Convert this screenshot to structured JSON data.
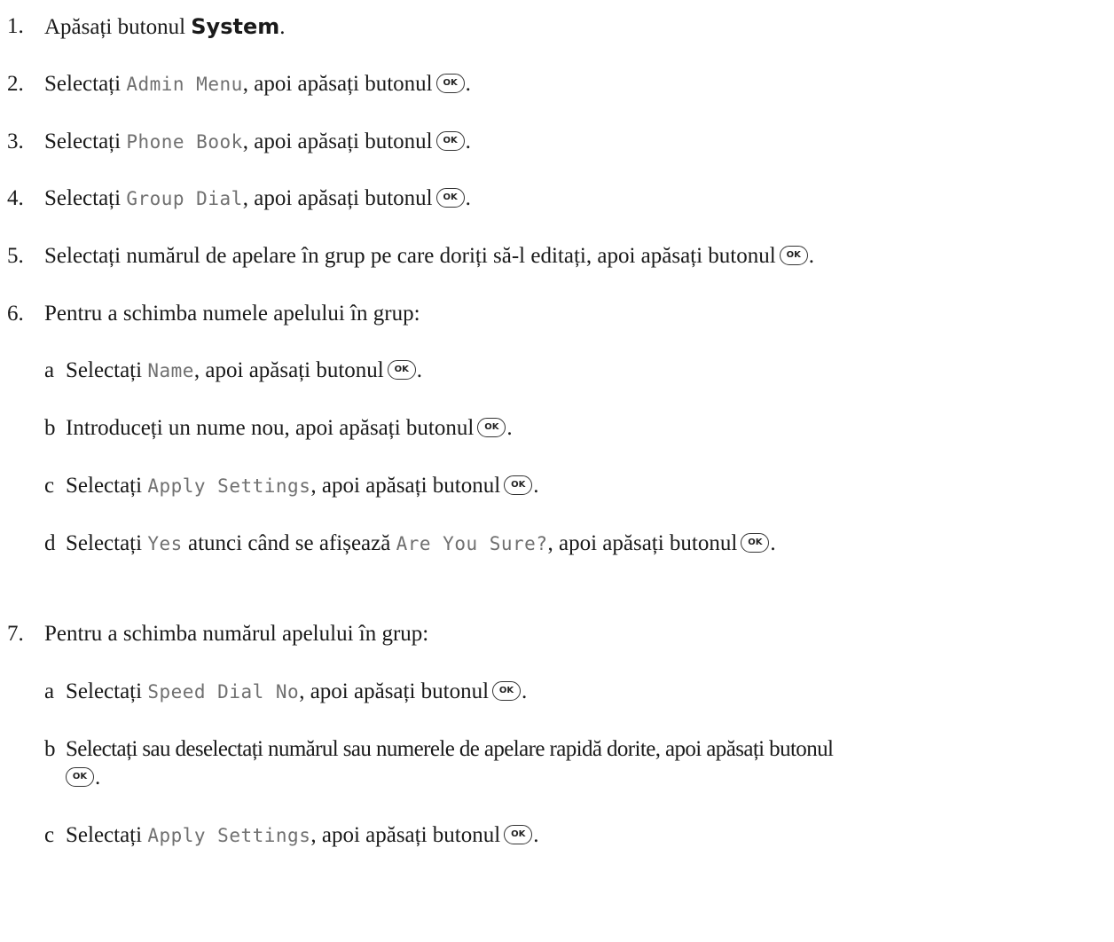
{
  "steps": [
    {
      "num": "1.",
      "pre": "Apăsați butonul ",
      "bold": "System",
      "post": "."
    },
    {
      "num": "2.",
      "pre": "Selectați ",
      "lcd": "Admin Menu",
      "post": ", apoi apăsați butonul",
      "end": "."
    },
    {
      "num": "3.",
      "pre": "Selectați ",
      "lcd": "Phone Book",
      "post": ", apoi apăsați butonul",
      "end": "."
    },
    {
      "num": "4.",
      "pre": "Selectați ",
      "lcd": "Group Dial",
      "post": ", apoi apăsați butonul",
      "end": "."
    },
    {
      "num": "5.",
      "text": "Selectați numărul de apelare în grup pe care doriți să-l editați, apoi apăsați butonul",
      "end": "."
    },
    {
      "num": "6.",
      "text": "Pentru a schimba numele apelului în grup:"
    },
    {
      "num": "7.",
      "text": "Pentru a schimba numărul apelului în grup:"
    }
  ],
  "step6_sub": [
    {
      "letter": "a",
      "pre": "Selectați ",
      "lcd": "Name",
      "post": ", apoi apăsați butonul",
      "end": "."
    },
    {
      "letter": "b",
      "text": "Introduceți un nume nou, apoi apăsați butonul",
      "end": "."
    },
    {
      "letter": "c",
      "pre": "Selectați ",
      "lcd": "Apply Settings",
      "post": ", apoi apăsați butonul",
      "end": "."
    },
    {
      "letter": "d",
      "pre": "Selectați ",
      "lcd": "Yes",
      "mid": " atunci când se afișează ",
      "lcd2": "Are You Sure?",
      "post": ", apoi apăsați butonul",
      "end": "."
    }
  ],
  "step7_sub": [
    {
      "letter": "a",
      "pre": "Selectați ",
      "lcd": "Speed Dial No",
      "post": ", apoi apăsați butonul",
      "end": "."
    },
    {
      "letter": "b",
      "text": "Selectați sau deselectați numărul sau numerele de apelare rapidă dorite, apoi apăsați butonul",
      "end": "."
    },
    {
      "letter": "c",
      "pre": "Selectați ",
      "lcd": "Apply Settings",
      "post": ", apoi apăsați butonul",
      "end": "."
    }
  ],
  "ok_label": "OK"
}
